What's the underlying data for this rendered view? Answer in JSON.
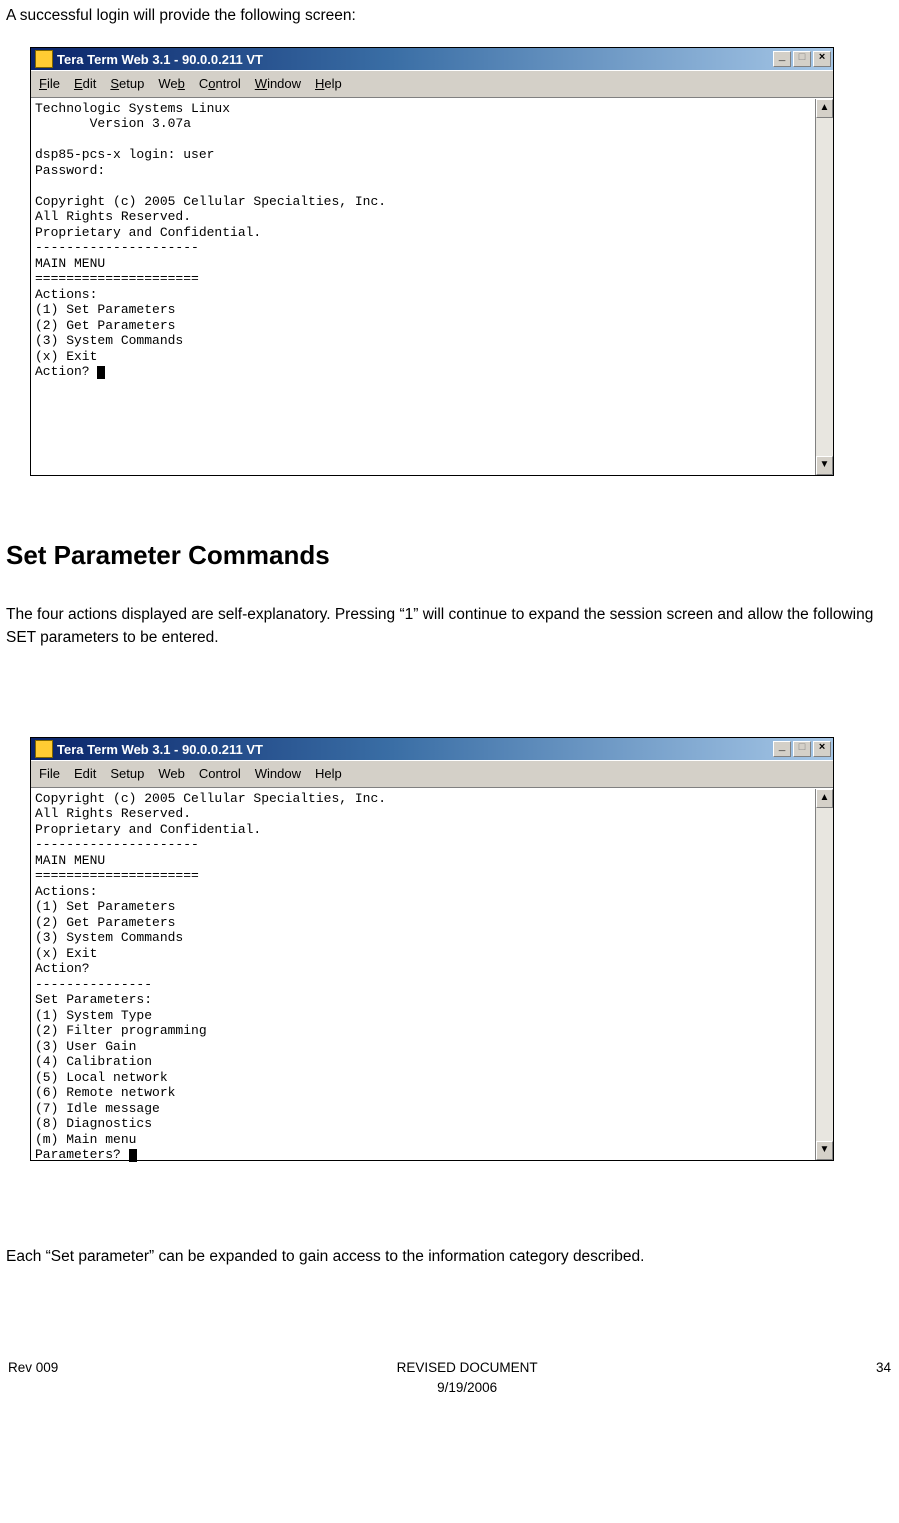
{
  "intro_text": "A successful login will provide the following screen:",
  "window1": {
    "title": "Tera Term Web 3.1 - 90.0.0.211 VT",
    "menus": [
      "File",
      "Edit",
      "Setup",
      "Web",
      "Control",
      "Window",
      "Help"
    ],
    "terminal": "Technologic Systems Linux\n       Version 3.07a\n\ndsp85-pcs-x login: user\nPassword:\n\nCopyright (c) 2005 Cellular Specialties, Inc.\nAll Rights Reserved.\nProprietary and Confidential.\n---------------------\nMAIN MENU\n=====================\nActions:\n(1) Set Parameters\n(2) Get Parameters\n(3) System Commands\n(x) Exit\nAction? "
  },
  "section_heading": "Set Parameter Commands",
  "section_para": "The four actions displayed are self-explanatory. Pressing “1” will continue to expand the session screen and allow the following SET parameters to be entered.",
  "window2": {
    "title": "Tera Term Web 3.1 - 90.0.0.211 VT",
    "menus": [
      "File",
      "Edit",
      "Setup",
      "Web",
      "Control",
      "Window",
      "Help"
    ],
    "terminal": "Copyright (c) 2005 Cellular Specialties, Inc.\nAll Rights Reserved.\nProprietary and Confidential.\n---------------------\nMAIN MENU\n=====================\nActions:\n(1) Set Parameters\n(2) Get Parameters\n(3) System Commands\n(x) Exit\nAction?\n---------------\nSet Parameters:\n(1) System Type\n(2) Filter programming\n(3) User Gain\n(4) Calibration\n(5) Local network\n(6) Remote network\n(7) Idle message\n(8) Diagnostics\n(m) Main menu\nParameters? "
  },
  "closing_para": "Each “Set parameter” can be expanded to gain access to the information category described.",
  "footer": {
    "left": "Rev 009",
    "center_line1": "REVISED DOCUMENT",
    "center_line2": "9/19/2006",
    "right": "34"
  },
  "buttons": {
    "min": "_",
    "max": "□",
    "close": "×",
    "up": "▲",
    "down": "▼"
  }
}
